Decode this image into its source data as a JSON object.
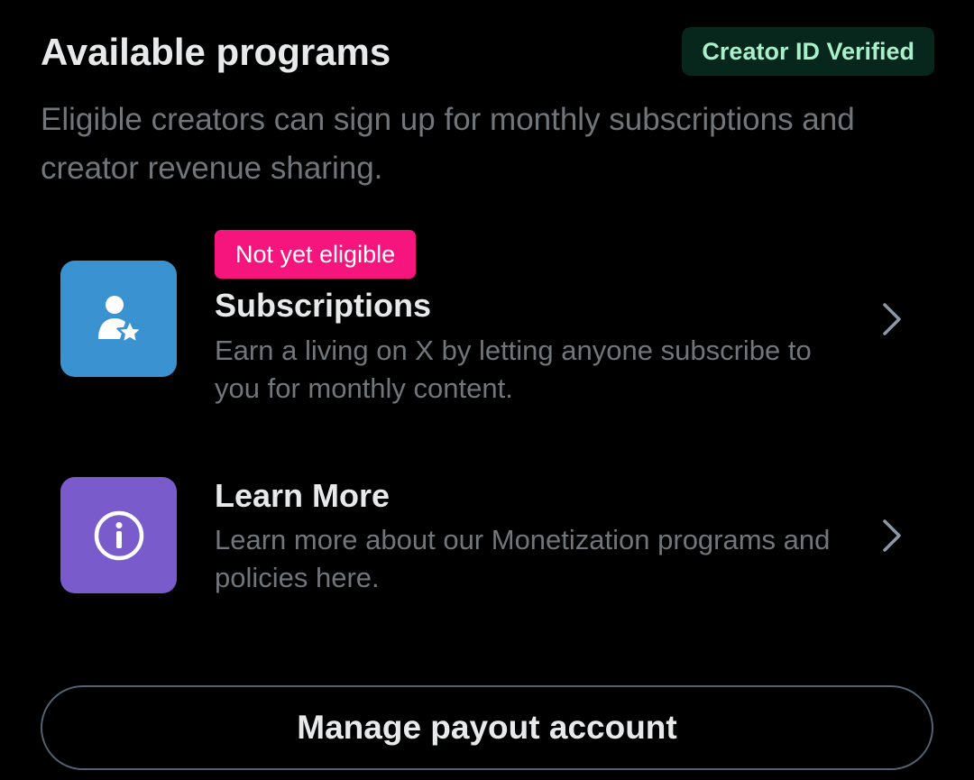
{
  "header": {
    "title": "Available programs",
    "badge": "Creator ID Verified"
  },
  "intro": {
    "text": "Eligible creators can sign up for monthly subscriptions and creator revenue sharing."
  },
  "programs": [
    {
      "badge": "Not yet eligible",
      "title": "Subscriptions",
      "description": "Earn a living on X by letting anyone subscribe to you for monthly content.",
      "icon": "person-star-icon",
      "tile_color": "#3a93d0"
    },
    {
      "title": "Learn More",
      "description": "Learn more about our Monetization programs and policies here.",
      "icon": "info-circle-icon",
      "tile_color": "#7a5bcc"
    }
  ],
  "footer": {
    "payout_button": "Manage payout account"
  },
  "colors": {
    "background": "#000000",
    "primary_text": "#e7e9ea",
    "secondary_text": "#71767b",
    "verified_badge_bg": "#07261c",
    "verified_badge_text": "#a7f0c9",
    "ineligible_badge_bg": "#f5157d",
    "button_border": "#536471"
  }
}
